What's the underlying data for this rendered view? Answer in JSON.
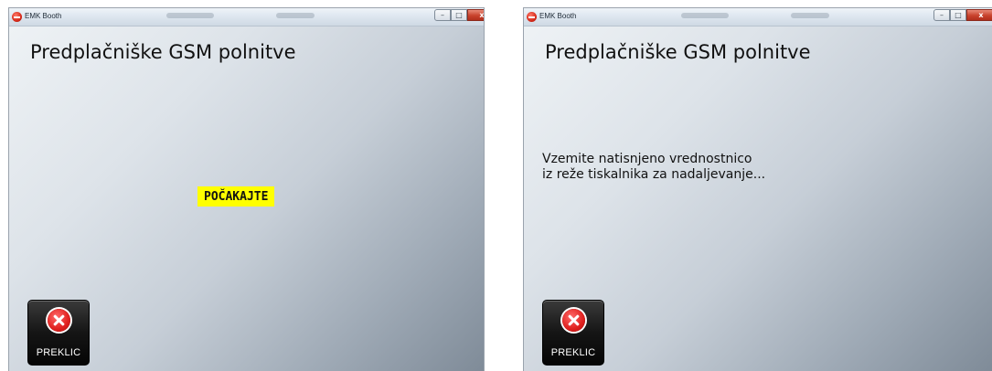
{
  "windows": [
    {
      "app_title": "EMK Booth",
      "page_title": "Predplačniške GSM polnitve",
      "status_badge": "POČAKAJTE",
      "cancel_label": "PREKLIC"
    },
    {
      "app_title": "EMK Booth",
      "page_title": "Predplačniške GSM polnitve",
      "message_lines": [
        "Vzemite natisnjeno vrednostnico",
        "iz reže tiskalnika za nadaljevanje..."
      ],
      "cancel_label": "PREKLIC"
    }
  ],
  "window_controls": {
    "minimize": "–",
    "maximize": "□",
    "close": "x"
  },
  "icons": {
    "app_icon": "emk-logo-icon",
    "cancel_icon": "red-x-circle-icon"
  },
  "colors": {
    "status_badge_bg": "#ffff00",
    "cancel_button_bg": "#111111",
    "cancel_icon": "#e0201e"
  }
}
